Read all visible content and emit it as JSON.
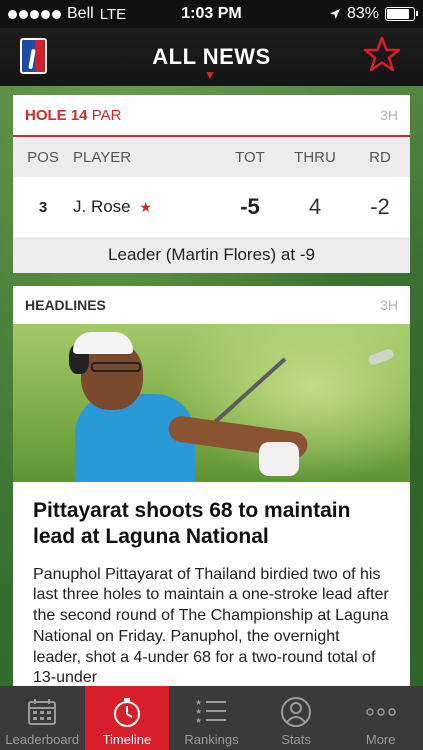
{
  "status": {
    "carrier": "Bell",
    "network": "LTE",
    "time": "1:03 PM",
    "battery": "83%",
    "battery_level": 0.83
  },
  "nav": {
    "logo": "PGA TOUR",
    "title": "ALL NEWS",
    "favorite_icon": "star-outline-icon"
  },
  "score_card": {
    "hole": "HOLE 14",
    "par": "PAR",
    "age": "3H",
    "columns": {
      "pos": "POS",
      "player": "PLAYER",
      "tot": "TOT",
      "thru": "THRU",
      "rd": "RD"
    },
    "row": {
      "pos": "3",
      "player": "J. Rose",
      "fav": "★",
      "tot": "-5",
      "thru": "4",
      "rd": "-2"
    },
    "leader": "Leader (Martin Flores) at -9"
  },
  "headlines": {
    "label": "HEADLINES",
    "age": "3H",
    "title": "Pittayarat shoots 68 to maintain lead at Laguna National",
    "summary": "Panuphol Pittayarat of Thailand birdied two of his last three holes to maintain a one-stroke lead after the second round of The Championship at Laguna National on Friday. Panuphol, the overnight leader, shot a 4-under 68 for a two-round total of 13-under"
  },
  "tabs": [
    {
      "label": "Leaderboard",
      "icon": "calendar-grid-icon",
      "active": false
    },
    {
      "label": "Timeline",
      "icon": "stopwatch-icon",
      "active": true
    },
    {
      "label": "Rankings",
      "icon": "star-list-icon",
      "active": false
    },
    {
      "label": "Stats",
      "icon": "user-icon",
      "active": false
    },
    {
      "label": "More",
      "icon": "more-dots-icon",
      "active": false
    }
  ],
  "colors": {
    "accent": "#d61f2a",
    "nav_bg": "#1a1a1a",
    "tab_bg": "#3a3a3a"
  }
}
